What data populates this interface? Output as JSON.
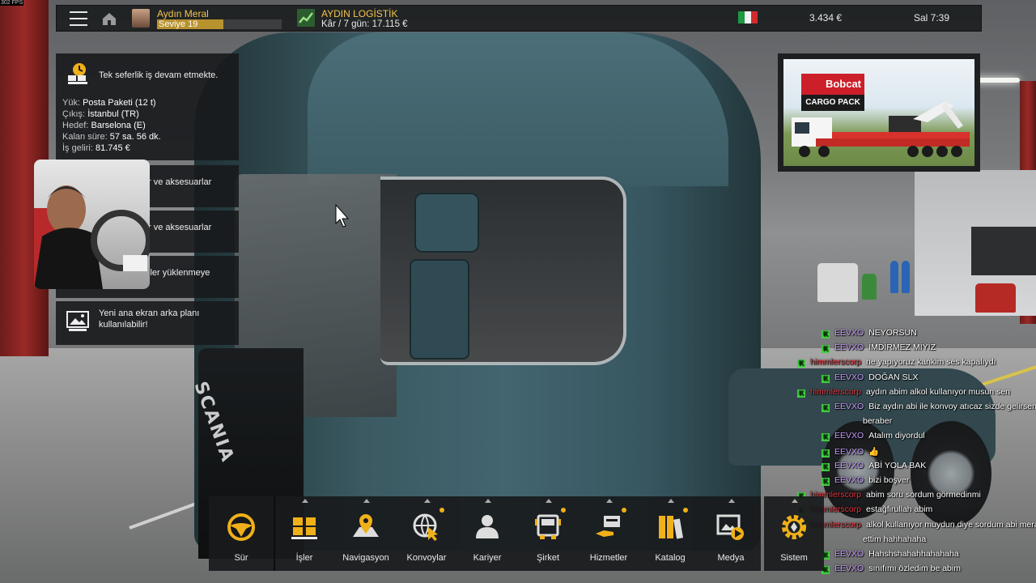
{
  "overlay": {
    "fps": "302 FPS"
  },
  "topbar": {
    "player_name": "Aydın Meral",
    "level": "Seviye 19",
    "company_name": "AYDIN LOGİSTİK",
    "company_profit": "Kâr / 7 gün: 17.115 €",
    "money": "3.434 €",
    "time": "Sal 7:39",
    "accent": "#f2c44a"
  },
  "notifications": {
    "job": {
      "title": "Tek seferlik iş devam etmekte.",
      "rows": [
        {
          "label": "Yük:",
          "value": "Posta Paketi (12 t)"
        },
        {
          "label": "Çıkış:",
          "value": "İstanbul (TR)"
        },
        {
          "label": "Hedef:",
          "value": "Barselona (E)"
        },
        {
          "label": "Kalan süre:",
          "value": "57 sa. 56 dk."
        },
        {
          "label": "İş geliri:",
          "value": "81.745 €"
        }
      ]
    },
    "items": [
      {
        "text": "r ve aksesuarlar"
      },
      {
        "text": "r ve aksesuarlar"
      },
      {
        "text": "iler yüklenmeye"
      }
    ],
    "background": {
      "text": "Yeni ana ekran arka planı kullanılabilir!"
    }
  },
  "ad": {
    "logo": "Bobcat",
    "subtitle": "CARGO PACK"
  },
  "chat": [
    {
      "badge": "K",
      "user": "EEVXO",
      "kind": "a",
      "msg": "NEYORSUN"
    },
    {
      "badge": "K",
      "user": "EEVXO",
      "kind": "a",
      "msg": "İMDİRMEZ MİYİZ"
    },
    {
      "badge": "K",
      "user": "himmlerscorp",
      "kind": "b",
      "msg": "ne yapıyoruz kankim ses kapalıydı"
    },
    {
      "badge": "K",
      "user": "EEVXO",
      "kind": "a",
      "msg": "DOĞAN SLX"
    },
    {
      "badge": "K",
      "user": "himmlerscorp",
      "kind": "b",
      "msg": "aydın abim alkol kullanıyor musun sen"
    },
    {
      "badge": "K",
      "user": "EEVXO",
      "kind": "a",
      "msg": "Biz aydın abi ile konvoy atıcaz sizde gelirseniz"
    },
    {
      "badge": "",
      "user": "",
      "kind": "a",
      "msg": "beraber"
    },
    {
      "badge": "K",
      "user": "EEVXO",
      "kind": "a",
      "msg": "Atalım diyordul"
    },
    {
      "badge": "K",
      "user": "EEVXO",
      "kind": "a",
      "msg": "👍"
    },
    {
      "badge": "K",
      "user": "EEVXO",
      "kind": "a",
      "msg": "ABİ YOLA BAK"
    },
    {
      "badge": "K",
      "user": "EEVXO",
      "kind": "a",
      "msg": "bizi boşver"
    },
    {
      "badge": "K",
      "user": "himmlerscorp",
      "kind": "b",
      "msg": "abim soru sordum görmedinmi"
    },
    {
      "badge": "K",
      "user": "himmlerscorp",
      "kind": "b",
      "msg": "estağfirullah abim"
    },
    {
      "badge": "K",
      "user": "himmlerscorp",
      "kind": "b",
      "msg": "alkol kullanıyor muydun diye sordum abi merak"
    },
    {
      "badge": "",
      "user": "",
      "kind": "b",
      "msg": "ettim hahhahaha"
    },
    {
      "badge": "K",
      "user": "EEVXO",
      "kind": "a",
      "msg": "Hahshshahahhahahaha"
    },
    {
      "badge": "K",
      "user": "EEVXO",
      "kind": "a",
      "msg": "sınıfımı özledim be abim"
    }
  ],
  "dock": {
    "items": [
      {
        "label": "Sür",
        "icon": "steering-wheel-icon"
      },
      {
        "label": "İşler",
        "icon": "pallet-boxes-icon"
      },
      {
        "label": "Navigasyon",
        "icon": "map-pin-icon"
      },
      {
        "label": "Konvoylar",
        "icon": "globe-cursor-icon"
      },
      {
        "label": "Kariyer",
        "icon": "person-icon"
      },
      {
        "label": "Şirket",
        "icon": "truck-front-icon"
      },
      {
        "label": "Hizmetler",
        "icon": "service-hand-icon"
      },
      {
        "label": "Katalog",
        "icon": "books-icon"
      },
      {
        "label": "Medya",
        "icon": "media-play-icon"
      }
    ],
    "system": {
      "label": "Sistem",
      "icon": "gear-icon"
    }
  }
}
